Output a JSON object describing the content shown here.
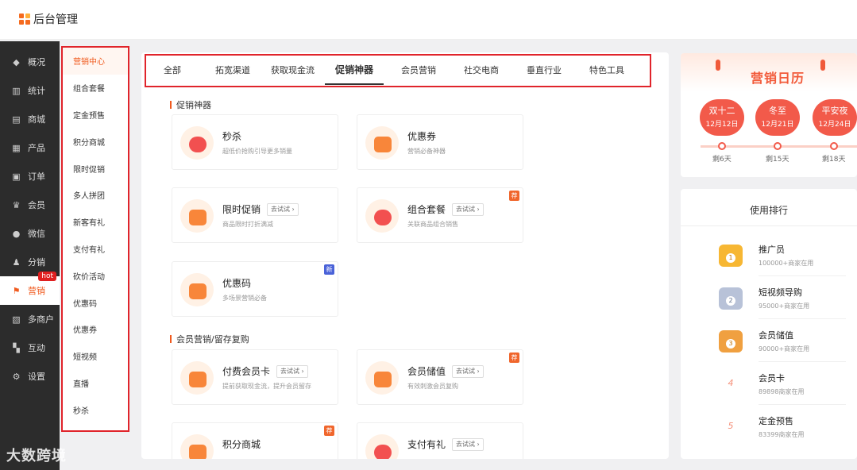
{
  "app": {
    "title": "后台管理"
  },
  "sidebar": {
    "items": [
      {
        "label": "概况",
        "icon": "layers-icon"
      },
      {
        "label": "统计",
        "icon": "stats-icon"
      },
      {
        "label": "商城",
        "icon": "shop-icon"
      },
      {
        "label": "产品",
        "icon": "grid-icon"
      },
      {
        "label": "订单",
        "icon": "order-icon"
      },
      {
        "label": "会员",
        "icon": "crown-icon"
      },
      {
        "label": "微信",
        "icon": "wechat-icon"
      },
      {
        "label": "分销",
        "icon": "user-icon"
      },
      {
        "label": "营销",
        "icon": "flag-icon",
        "badge": "hot"
      },
      {
        "label": "多商户",
        "icon": "store-icon"
      },
      {
        "label": "互动",
        "icon": "apps-icon"
      },
      {
        "label": "设置",
        "icon": "gear-icon"
      }
    ]
  },
  "submenu": {
    "items": [
      "营销中心",
      "组合套餐",
      "定金预售",
      "积分商城",
      "限时促销",
      "多人拼团",
      "新客有礼",
      "支付有礼",
      "砍价活动",
      "优惠码",
      "优惠券",
      "短视频",
      "直播",
      "秒杀"
    ]
  },
  "tabs": [
    "全部",
    "拓宽渠道",
    "获取现金流",
    "促销神器",
    "会员营销",
    "社交电商",
    "垂直行业",
    "特色工具"
  ],
  "sections": {
    "promo": {
      "title": "促销神器",
      "cards": [
        {
          "title": "秒杀",
          "sub": "超低价抢购引导更多销量"
        },
        {
          "title": "优惠券",
          "sub": "营销必备神器"
        },
        {
          "title": "限时促销",
          "try": "去试试",
          "sub": "商品限时打折满减"
        },
        {
          "title": "组合套餐",
          "try": "去试试",
          "sub": "关联商品组合销售",
          "tag": "荐"
        },
        {
          "title": "优惠码",
          "sub": "多场景营销必备",
          "tag": "新"
        }
      ]
    },
    "member": {
      "title": "会员营销/留存复购",
      "cards": [
        {
          "title": "付费会员卡",
          "try": "去试试",
          "sub": "提前获取现金流，提升会员留存"
        },
        {
          "title": "会员储值",
          "try": "去试试",
          "sub": "有效刺激会员复购",
          "tag": "荐"
        },
        {
          "title": "积分商城",
          "sub": "",
          "tag": "荐"
        },
        {
          "title": "支付有礼",
          "try": "去试试",
          "sub": ""
        }
      ]
    }
  },
  "calendar": {
    "title": "营销日历",
    "events": [
      {
        "name": "双十二",
        "date": "12月12日",
        "remain": "剩6天"
      },
      {
        "name": "冬至",
        "date": "12月21日",
        "remain": "剩15天"
      },
      {
        "name": "平安夜",
        "date": "12月24日",
        "remain": "剩18天"
      }
    ]
  },
  "ranking": {
    "title": "使用排行",
    "items": [
      {
        "rank": "1",
        "name": "推广员",
        "count": "100000+商家在用"
      },
      {
        "rank": "2",
        "name": "短视频导购",
        "count": "95000+商家在用"
      },
      {
        "rank": "3",
        "name": "会员储值",
        "count": "90000+商家在用"
      },
      {
        "rank": "4",
        "name": "会员卡",
        "count": "89898商家在用"
      },
      {
        "rank": "5",
        "name": "定金预售",
        "count": "83399商家在用"
      }
    ]
  },
  "watermark": "大数跨境",
  "colors": {
    "accent": "#f05a1e",
    "highlight_border": "#e0242b",
    "sidebar_bg": "#2c2c2c"
  }
}
